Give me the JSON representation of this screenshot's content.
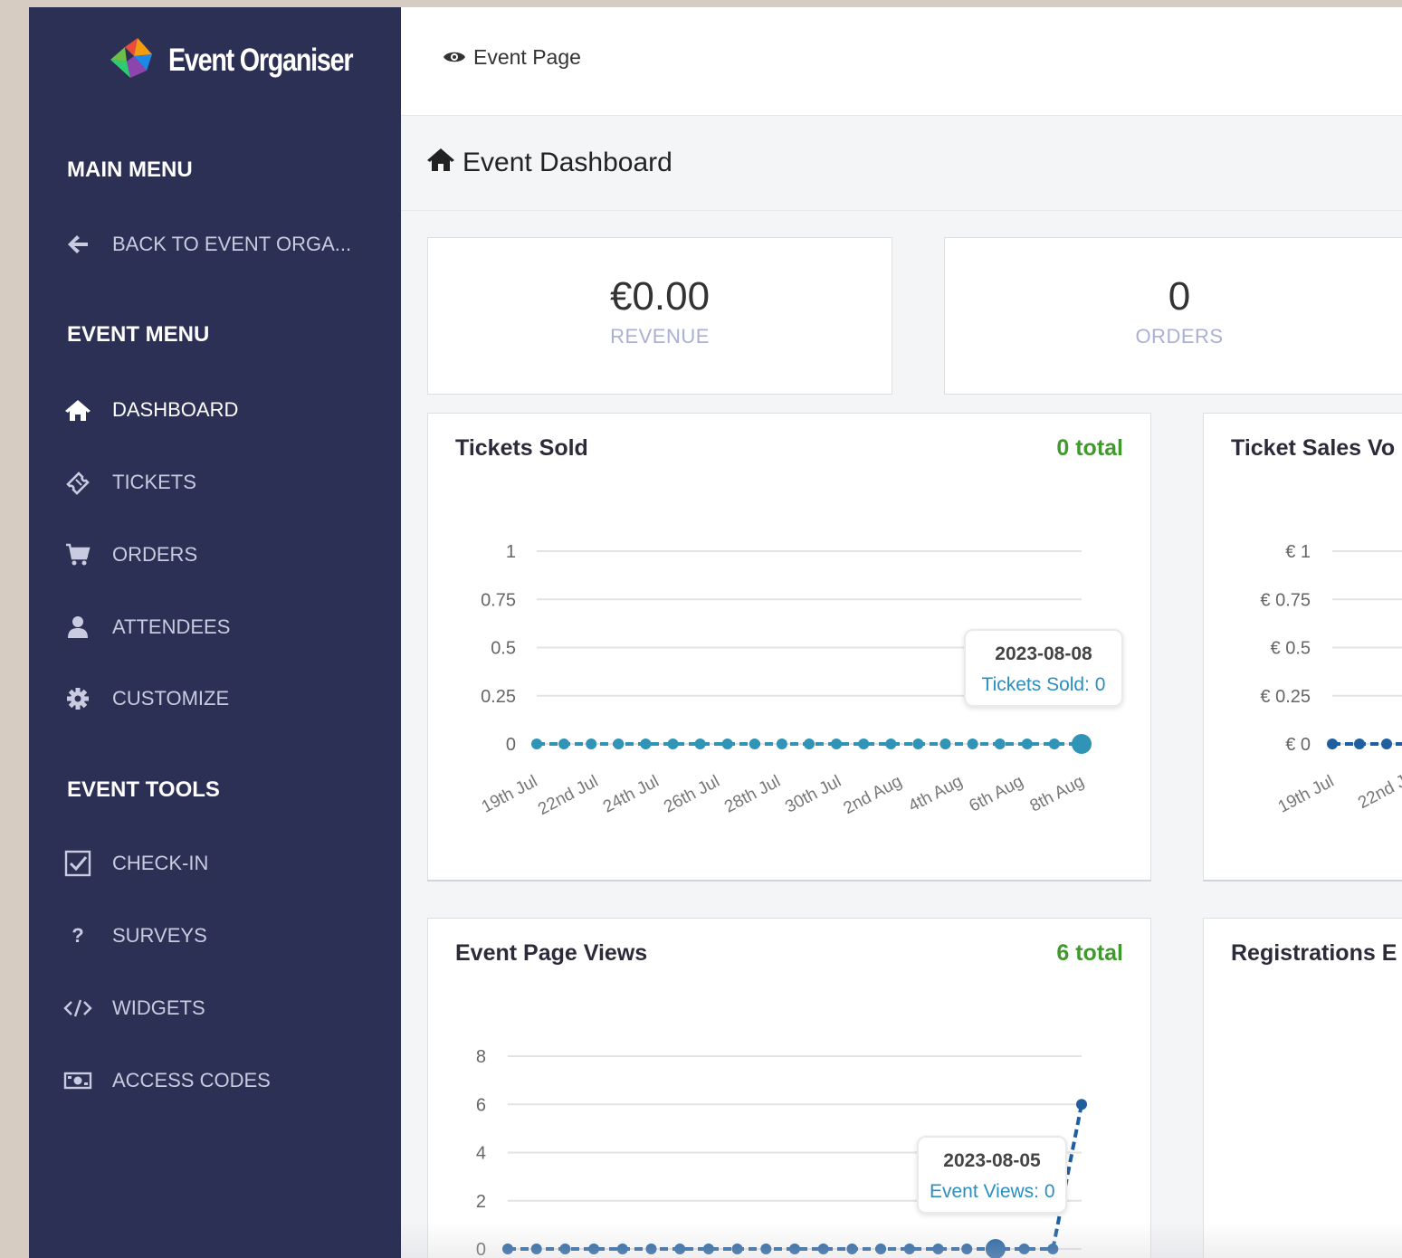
{
  "brand": {
    "name": "Event Organiser"
  },
  "sidebar": {
    "main_menu_heading": "MAIN MENU",
    "back_item": {
      "label": "BACK TO EVENT ORGA...",
      "icon": "arrow-left-icon"
    },
    "event_menu_heading": "EVENT MENU",
    "event_menu": [
      {
        "label": "DASHBOARD",
        "icon": "home-icon",
        "active": true
      },
      {
        "label": "TICKETS",
        "icon": "ticket-icon"
      },
      {
        "label": "ORDERS",
        "icon": "cart-icon"
      },
      {
        "label": "ATTENDEES",
        "icon": "user-icon"
      },
      {
        "label": "CUSTOMIZE",
        "icon": "gear-icon"
      }
    ],
    "event_tools_heading": "EVENT TOOLS",
    "event_tools": [
      {
        "label": "CHECK-IN",
        "icon": "checkbox-icon"
      },
      {
        "label": "SURVEYS",
        "icon": "question-icon"
      },
      {
        "label": "WIDGETS",
        "icon": "code-icon"
      },
      {
        "label": "ACCESS CODES",
        "icon": "money-icon"
      }
    ]
  },
  "topbar": {
    "event_page_link": "Event Page"
  },
  "page": {
    "title": "Event Dashboard"
  },
  "stats": [
    {
      "value": "€0.00",
      "label": "REVENUE"
    },
    {
      "value": "0",
      "label": "ORDERS"
    }
  ],
  "colors": {
    "sidebar_bg": "#2c3054",
    "accent_teal": "#2f94b6",
    "accent_blue": "#1f5fa0",
    "total_green": "#3f9a2b"
  },
  "chart_data": [
    {
      "type": "line",
      "title": "Tickets Sold",
      "total": "0 total",
      "x": [
        "2023-07-19",
        "2023-07-20",
        "2023-07-21",
        "2023-07-22",
        "2023-07-23",
        "2023-07-24",
        "2023-07-25",
        "2023-07-26",
        "2023-07-27",
        "2023-07-28",
        "2023-07-29",
        "2023-07-30",
        "2023-07-31",
        "2023-08-01",
        "2023-08-02",
        "2023-08-03",
        "2023-08-04",
        "2023-08-05",
        "2023-08-06",
        "2023-08-07",
        "2023-08-08"
      ],
      "values": [
        0,
        0,
        0,
        0,
        0,
        0,
        0,
        0,
        0,
        0,
        0,
        0,
        0,
        0,
        0,
        0,
        0,
        0,
        0,
        0,
        0
      ],
      "y_ticks": [
        "1",
        "0.75",
        "0.5",
        "0.25",
        "0"
      ],
      "x_tick_labels": [
        "19th Jul",
        "22nd Jul",
        "24th Jul",
        "26th Jul",
        "28th Jul",
        "30th Jul",
        "2nd Aug",
        "4th Aug",
        "6th Aug",
        "8th Aug"
      ],
      "ylim": [
        0,
        1
      ],
      "grid": true,
      "color": "#2f94b6",
      "tooltip": {
        "date": "2023-08-08",
        "text": "Tickets Sold: 0"
      }
    },
    {
      "type": "line",
      "title": "Ticket Sales Vo",
      "y_ticks": [
        "€ 1",
        "€ 0.75",
        "€ 0.5",
        "€ 0.25",
        "€ 0"
      ],
      "x_tick_labels": [
        "19th Jul",
        "22nd J"
      ],
      "values": [
        0,
        0,
        0,
        0
      ],
      "ylim": [
        0,
        1
      ],
      "color": "#1f5fa0"
    },
    {
      "type": "line",
      "title": "Event Page Views",
      "total": "6 total",
      "x": [
        "2023-07-19",
        "2023-07-20",
        "2023-07-21",
        "2023-07-22",
        "2023-07-23",
        "2023-07-24",
        "2023-07-25",
        "2023-07-26",
        "2023-07-27",
        "2023-07-28",
        "2023-07-29",
        "2023-07-30",
        "2023-07-31",
        "2023-08-01",
        "2023-08-02",
        "2023-08-03",
        "2023-08-04",
        "2023-08-05",
        "2023-08-06",
        "2023-08-07",
        "2023-08-08"
      ],
      "values": [
        0,
        0,
        0,
        0,
        0,
        0,
        0,
        0,
        0,
        0,
        0,
        0,
        0,
        0,
        0,
        0,
        0,
        0,
        0,
        0,
        6
      ],
      "y_ticks": [
        "8",
        "6",
        "4",
        "2",
        "0"
      ],
      "ylim": [
        0,
        8
      ],
      "grid": true,
      "color": "#1f5fa0",
      "tooltip": {
        "date": "2023-08-05",
        "text": "Event Views: 0"
      }
    },
    {
      "type": "line",
      "title": "Registrations E"
    }
  ]
}
